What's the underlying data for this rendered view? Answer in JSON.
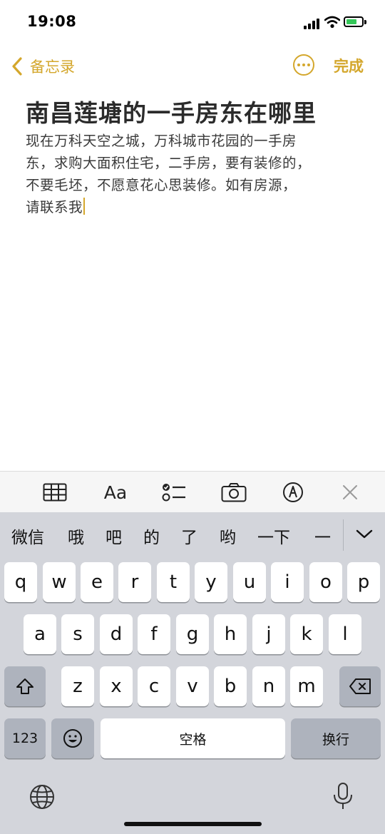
{
  "status_bar": {
    "time": "19:08"
  },
  "nav": {
    "back_label": "备忘录",
    "done_label": "完成"
  },
  "note": {
    "title": "南昌莲塘的一手房东在哪里",
    "body_lines": [
      "现在万科天空之城，万科城市花园的一手房",
      "东，求购大面积住宅，二手房，要有装修的，",
      "不要毛坯，不愿意花心思装修。如有房源，",
      "请联系我"
    ]
  },
  "format_toolbar": {
    "items": [
      "table-icon",
      "Aa",
      "checklist-icon",
      "camera-icon",
      "markup-pen-icon",
      "close-icon"
    ],
    "text_style_label": "Aa"
  },
  "keyboard": {
    "candidates": [
      "微信",
      "哦",
      "吧",
      "的",
      "了",
      "哟",
      "一下",
      "一"
    ],
    "row1": [
      "q",
      "w",
      "e",
      "r",
      "t",
      "y",
      "u",
      "i",
      "o",
      "p"
    ],
    "row2": [
      "a",
      "s",
      "d",
      "f",
      "g",
      "h",
      "j",
      "k",
      "l"
    ],
    "row3": [
      "z",
      "x",
      "c",
      "v",
      "b",
      "n",
      "m"
    ],
    "numbers_label": "123",
    "space_label": "空格",
    "return_label": "换行"
  },
  "colors": {
    "accent": "#d4a72c",
    "keyboard_bg": "#d3d5db"
  }
}
